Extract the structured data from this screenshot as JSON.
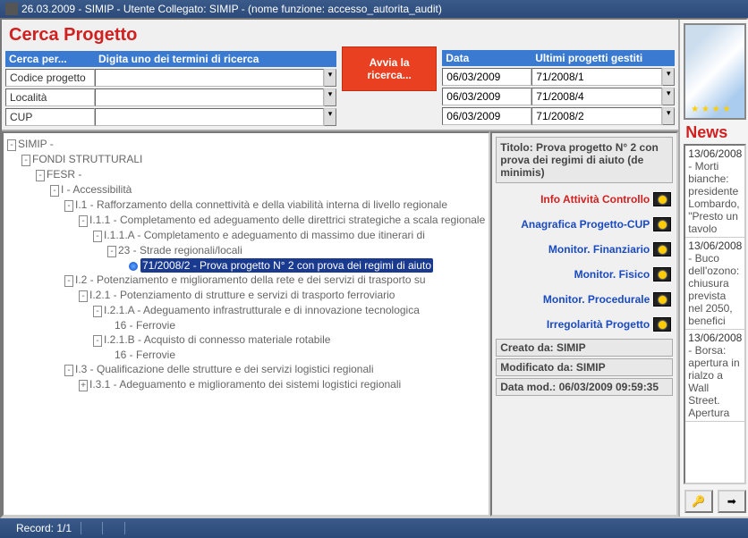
{
  "titlebar": "26.03.2009 - SIMIP - Utente Collegato: SIMIP - (nome funzione: accesso_autorita_audit)",
  "search": {
    "title": "Cerca Progetto",
    "hdr1": "Cerca per...",
    "hdr2": "Digita uno dei termini di ricerca",
    "rows": [
      {
        "label": "Codice progetto",
        "value": ""
      },
      {
        "label": "Località",
        "value": ""
      },
      {
        "label": "CUP",
        "value": ""
      }
    ],
    "button": "Avvia la ricerca..."
  },
  "recent": {
    "hdr1": "Data",
    "hdr2": "Ultimi progetti gestiti",
    "rows": [
      {
        "date": "06/03/2009",
        "proj": "71/2008/1"
      },
      {
        "date": "06/03/2009",
        "proj": "71/2008/4"
      },
      {
        "date": "06/03/2009",
        "proj": "71/2008/2"
      }
    ]
  },
  "tree": {
    "n0": "SIMIP -",
    "n1": "FONDI STRUTTURALI",
    "n2": "FESR -",
    "n3": "I - Accessibilità",
    "n4": "I.1 - Rafforzamento della connettività e della viabilità interna di livello regionale",
    "n5": "I.1.1 - Completamento ed adeguamento delle direttrici strategiche a scala regionale",
    "n6": "I.1.1.A - Completamento e adeguamento di massimo due itinerari di",
    "n7": "23 - Strade regionali/locali",
    "n8": "71/2008/2 - Prova progetto N° 2 con prova dei regimi di aiuto",
    "n9": "I.2 - Potenziamento e miglioramento della rete e dei servizi di trasporto su",
    "n10": "I.2.1 - Potenziamento di strutture e servizi di trasporto ferroviario",
    "n11": "I.2.1.A - Adeguamento infrastrutturale e di innovazione tecnologica",
    "n12": "16 - Ferrovie",
    "n13": "I.2.1.B - Acquisto di connesso materiale rotabile",
    "n14": "16 - Ferrovie",
    "n15": "I.3 - Qualificazione delle strutture e dei servizi logistici regionali",
    "n16": "I.3.1 - Adeguamento e miglioramento dei sistemi logistici regionali"
  },
  "info": {
    "titolo": "Titolo: Prova progetto N° 2 con prova dei regimi di aiuto (de minimis)",
    "links": [
      "Info Attività Controllo",
      "Anagrafica Progetto-CUP",
      "Monitor. Finanziario",
      "Monitor. Fisico",
      "Monitor. Procedurale",
      "Irregolarità Progetto"
    ],
    "creato": "Creato da: SIMIP",
    "modificato": "Modificato da: SIMIP",
    "datamod": "Data mod.: 06/03/2009 09:59:35"
  },
  "news": {
    "title": "News",
    "items": [
      {
        "date": "13/06/2008",
        "text": " - Morti bianche: presidente Lombardo, \"Presto un tavolo"
      },
      {
        "date": "13/06/2008",
        "text": " - Buco dell'ozono: chiusura prevista nel 2050, benefici"
      },
      {
        "date": "13/06/2008",
        "text": " - Borsa: apertura in rialzo a Wall Street. Apertura"
      }
    ]
  },
  "status": {
    "record": "Record: 1/1"
  }
}
